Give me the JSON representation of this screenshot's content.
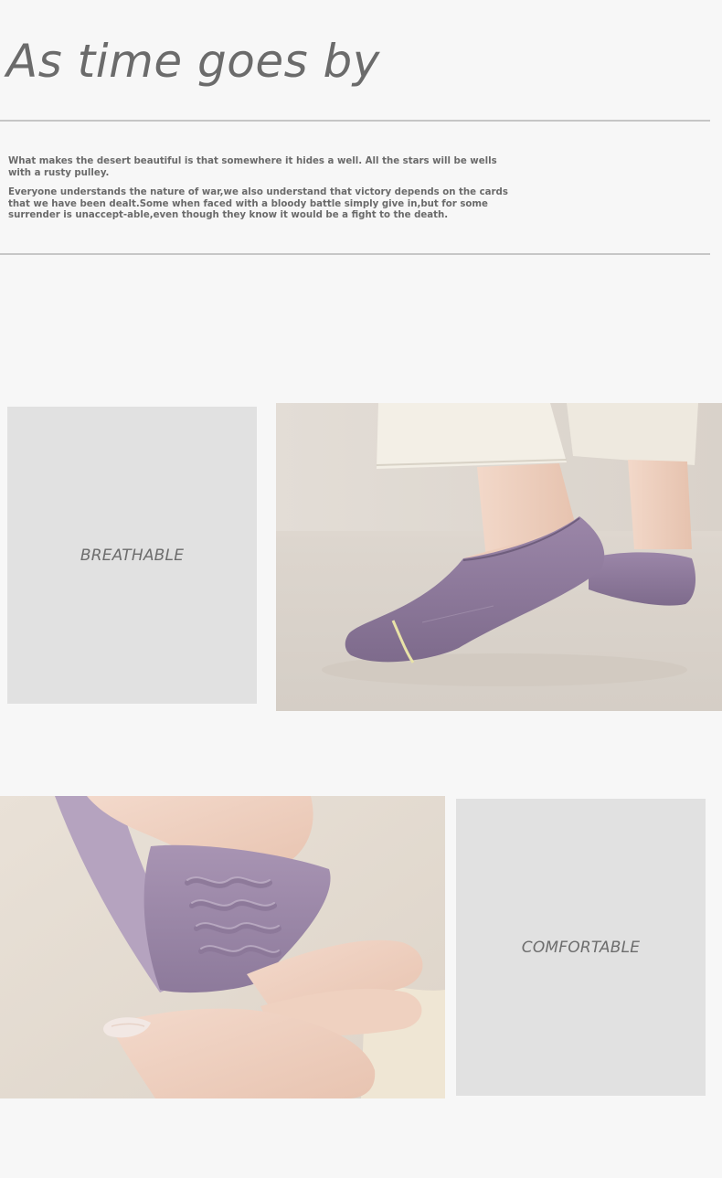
{
  "header": {
    "title": "As time goes by"
  },
  "intro": {
    "paragraphs": [
      "What makes the desert beautiful is that somewhere it hides a well. All the stars will be wells with a rusty pulley.",
      "Everyone understands the nature of war,we also understand that victory depends on the cards that we have been dealt.Some when faced with a bloody battle simply give in,but for some surrender is unaccept-able,even though they know it would be a fight to the death."
    ]
  },
  "features": [
    {
      "label": "BREATHABLE"
    },
    {
      "label": "COMFORTABLE"
    }
  ],
  "colors": {
    "background": "#f7f7f7",
    "panel": "#e1e1e1",
    "text": "#6b6b6b",
    "rule": "#c6c6c6",
    "sock": "#8e7a9c"
  }
}
